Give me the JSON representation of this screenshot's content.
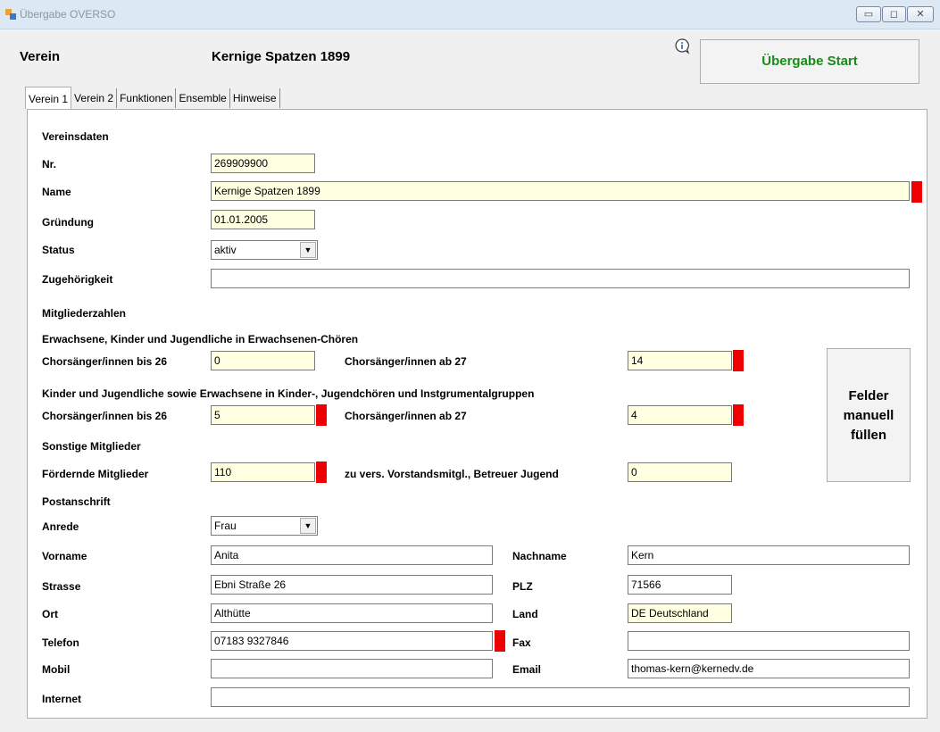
{
  "window": {
    "title": "Übergabe OVERSO"
  },
  "header": {
    "verein_label": "Verein",
    "verein_name": "Kernige Spatzen  1899",
    "start_button": "Übergabe Start"
  },
  "tabs": [
    {
      "label": "Verein 1"
    },
    {
      "label": "Verein 2"
    },
    {
      "label": "Funktionen"
    },
    {
      "label": "Ensemble"
    },
    {
      "label": "Hinweise"
    }
  ],
  "vereinsdaten": {
    "section": "Vereinsdaten",
    "nr_label": "Nr.",
    "nr_value": "269909900",
    "name_label": "Name",
    "name_value": "Kernige Spatzen  1899",
    "gruendung_label": "Gründung",
    "gruendung_value": "01.01.2005",
    "status_label": "Status",
    "status_value": "aktiv",
    "zugehoerigkeit_label": "Zugehörigkeit",
    "zugehoerigkeit_value": ""
  },
  "mitglieder": {
    "section": "Mitgliederzahlen",
    "group1": "Erwachsene, Kinder und Jugendliche in Erwachsenen-Chören",
    "g1_bis26_label": "Chorsänger/innen bis 26",
    "g1_bis26_value": "0",
    "g1_ab27_label": "Chorsänger/innen ab 27",
    "g1_ab27_value": "14",
    "group2": "Kinder und Jugendliche sowie Erwachsene in Kinder-, Jugendchören und Instgrumentalgruppen",
    "g2_bis26_label": "Chorsänger/innen bis 26",
    "g2_bis26_value": "5",
    "g2_ab27_label": "Chorsänger/innen ab 27",
    "g2_ab27_value": "4",
    "group3": "Sonstige Mitglieder",
    "foerdernd_label": "Fördernde Mitglieder",
    "foerdernd_value": "110",
    "vorstand_label": "zu vers. Vorstandsmitgl., Betreuer Jugend",
    "vorstand_value": "0",
    "manual_button": [
      "Felder",
      "manuell",
      "füllen"
    ]
  },
  "postanschrift": {
    "section": "Postanschrift",
    "anrede_label": "Anrede",
    "anrede_value": "Frau",
    "vorname_label": "Vorname",
    "vorname_value": "Anita",
    "nachname_label": "Nachname",
    "nachname_value": "Kern",
    "strasse_label": "Strasse",
    "strasse_value": "Ebni Straße 26",
    "plz_label": "PLZ",
    "plz_value": "71566",
    "ort_label": "Ort",
    "ort_value": "Althütte",
    "land_label": "Land",
    "land_value": "DE Deutschland",
    "telefon_label": "Telefon",
    "telefon_value": "07183 9327846",
    "fax_label": "Fax",
    "fax_value": "",
    "mobil_label": "Mobil",
    "mobil_value": "",
    "email_label": "Email",
    "email_value": "thomas-kern@kernedv.de",
    "internet_label": "Internet",
    "internet_value": ""
  },
  "colors": {
    "required_marker": "#ee0000",
    "start_text": "#1a8a1a",
    "field_highlight": "#ffffe1"
  }
}
